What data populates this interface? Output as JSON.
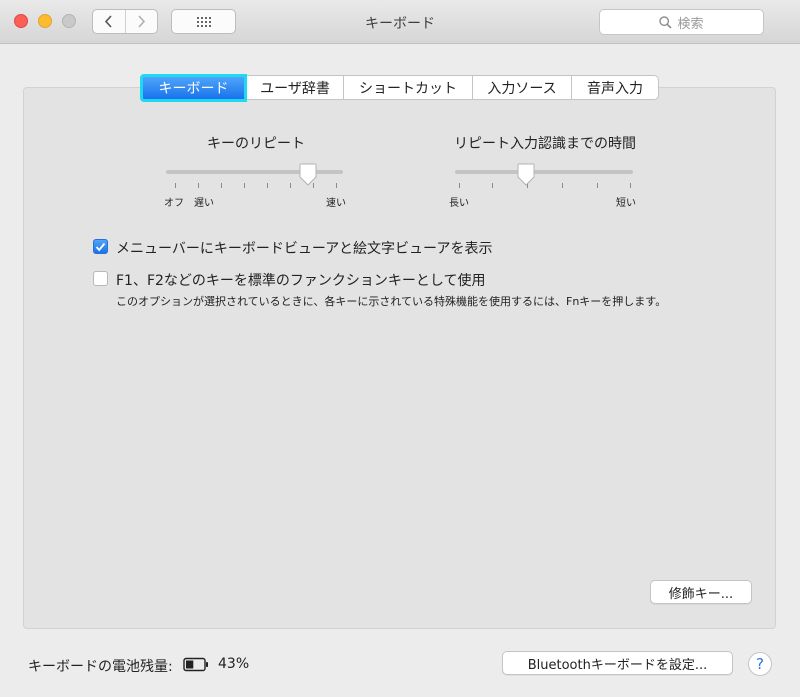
{
  "window": {
    "title": "キーボード"
  },
  "search": {
    "placeholder": "検索"
  },
  "tabs": [
    {
      "label": "キーボード",
      "active": true
    },
    {
      "label": "ユーザ辞書",
      "active": false
    },
    {
      "label": "ショートカット",
      "active": false
    },
    {
      "label": "入力ソース",
      "active": false
    },
    {
      "label": "音声入力",
      "active": false
    }
  ],
  "key_repeat": {
    "title": "キーのリピート",
    "min_label1": "オフ",
    "min_label2": "遅い",
    "max_label": "速い",
    "level": 0.8
  },
  "repeat_delay": {
    "title": "リピート入力認識までの時間",
    "min_label": "長い",
    "max_label": "短い",
    "level": 0.4
  },
  "options": {
    "viewer": {
      "label": "メニューバーにキーボードビューアと絵文字ビューアを表示",
      "checked": true
    },
    "fn_keys": {
      "label": "F1、F2などのキーを標準のファンクションキーとして使用",
      "checked": false
    },
    "fn_note": "このオプションが選択されているときに、各キーに示されている特殊機能を使用するには、Fnキーを押します。"
  },
  "buttons": {
    "modifier": "修飾キー...",
    "bluetooth": "Bluetoothキーボードを設定..."
  },
  "battery": {
    "label": "キーボードの電池残量:",
    "percent": "43%",
    "level": 0.43
  },
  "colors": {
    "accent": "#1972ec",
    "focus_ring": "#1fd8f2",
    "close": "#fc5f57",
    "minimize": "#fdbc2e"
  },
  "icons": {
    "back": "chevron-left-icon",
    "forward": "chevron-right-icon",
    "grid": "grid-icon",
    "search": "search-icon",
    "help": "help-icon",
    "battery": "battery-icon"
  }
}
